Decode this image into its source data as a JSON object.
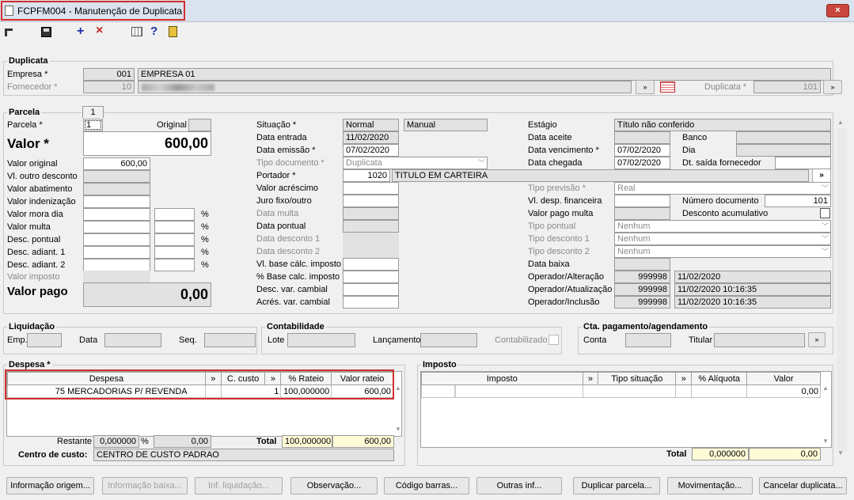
{
  "window": {
    "title": "FCPFM004 - Manutenção de Duplicata",
    "close": "×"
  },
  "toolbar": {
    "add": "+",
    "delete": "×",
    "help": "?"
  },
  "duplicata": {
    "title": "Duplicata",
    "empresa_label": "Empresa *",
    "empresa_code": "001",
    "empresa_name": "EMPRESA 01",
    "fornecedor_label": "Fornecedor *",
    "fornecedor_code": "10",
    "fornecedor_name": "",
    "duplicata_label": "Duplicata *",
    "duplicata_value": "101"
  },
  "parcela": {
    "title": "Parcela",
    "tab_number": "1",
    "parcela_label": "Parcela *",
    "parcela_value": "1",
    "original_label": "Original",
    "valor_label": "Valor *",
    "valor_value": "600,00",
    "left_fields": [
      {
        "label": "Valor original",
        "value": "600,00",
        "pct": false,
        "ro": false
      },
      {
        "label": "Vl. outro desconto",
        "value": "",
        "pct": false,
        "ro": true
      },
      {
        "label": "Valor abatimento",
        "value": "",
        "pct": false,
        "ro": true
      },
      {
        "label": "Valor indenização",
        "value": "",
        "pct": false,
        "ro": false
      },
      {
        "label": "Valor mora dia",
        "value": "",
        "pct": true,
        "ro": false
      },
      {
        "label": "Valor multa",
        "value": "",
        "pct": true,
        "ro": false
      },
      {
        "label": "Desc. pontual",
        "value": "",
        "pct": true,
        "ro": false
      },
      {
        "label": "Desc. adiant. 1",
        "value": "",
        "pct": true,
        "ro": false
      },
      {
        "label": "Desc. adiant. 2",
        "value": "",
        "pct": true,
        "ro": false
      }
    ],
    "pct_symbol": "%",
    "valor_imposto_label": "Valor imposto",
    "valor_pago_label": "Valor pago",
    "valor_pago_value": "0,00",
    "situacao_label": "Situação *",
    "situacao_value": "Normal",
    "situacao_tipo": "Manual",
    "data_entrada_label": "Data entrada",
    "data_entrada_value": "11/02/2020",
    "data_emissao_label": "Data emissão *",
    "data_emissao_value": "07/02/2020",
    "tipo_documento_label": "Tipo documento *",
    "tipo_documento_value": "Duplicata",
    "portador_label": "Portador *",
    "portador_code": "1020",
    "portador_name": "TITULO EM CARTEIRA",
    "mid_labels": [
      "Valor acréscimo",
      "Juro fixo/outro",
      "Data multa",
      "Data pontual",
      "Data desconto 1",
      "Data desconto 2",
      "Vl. base cálc. imposto",
      "% Base calc. imposto",
      "Desc. var. cambial",
      "Acrés. var. cambial"
    ],
    "estagio_label": "Estágio",
    "estagio_value": "Título não conferido",
    "data_aceite_label": "Data aceite",
    "banco_label": "Banco",
    "data_vencimento_label": "Data vencimento *",
    "data_vencimento_value": "07/02/2020",
    "dia_label": "Dia",
    "data_chegada_label": "Data chegada",
    "data_chegada_value": "07/02/2020",
    "dt_saida_label": "Dt. saída fornecedor",
    "tipo_previsao_label": "Tipo previsão *",
    "tipo_previsao_value": "Real",
    "vl_desp_label": "Vl. desp. financeira",
    "numero_documento_label": "Número documento",
    "numero_documento_value": "101",
    "valor_pago_multa_label": "Valor pago multa",
    "desconto_acumulativo_label": "Desconto acumulativo",
    "tipo_pontual_label": "Tipo pontual",
    "tipo_pontual_value": "Nenhum",
    "tipo_desconto1_label": "Tipo desconto 1",
    "tipo_desconto1_value": "Nenhum",
    "tipo_desconto2_label": "Tipo desconto 2",
    "tipo_desconto2_value": "Nenhum",
    "data_baixa_label": "Data baixa",
    "operadores": [
      {
        "label": "Operador/Alteração",
        "code": "999998",
        "date": "11/02/2020"
      },
      {
        "label": "Operador/Atualização",
        "code": "999998",
        "date": "11/02/2020 10:16:35"
      },
      {
        "label": "Operador/Inclusão",
        "code": "999998",
        "date": "11/02/2020 10:16:35"
      }
    ]
  },
  "liquidacao": {
    "title": "Liquidação",
    "emp_label": "Emp.",
    "data_label": "Data",
    "seq_label": "Seq."
  },
  "contabilidade": {
    "title": "Contabilidade",
    "lote_label": "Lote",
    "lancamento_label": "Lançamento",
    "contabilizado_label": "Contabilizado"
  },
  "cta": {
    "title": "Cta. pagamento/agendamento",
    "conta_label": "Conta",
    "titular_label": "Titular"
  },
  "despesa": {
    "title": "Despesa *",
    "headers": [
      "Despesa",
      "»",
      "C. custo",
      "»",
      "% Rateio",
      "Valor rateio"
    ],
    "rows": [
      {
        "code": "75",
        "name": "MERCADORIAS P/ REVENDA",
        "ccusto": "1",
        "rateio": "100,000000",
        "valor": "600,00"
      }
    ],
    "restante_label": "Restante",
    "restante_pct": "0,000000",
    "restante_pct_symbol": "%",
    "restante_valor": "0,00",
    "total_label": "Total",
    "total_pct": "100,000000",
    "total_valor": "600,00",
    "centro_label": "Centro de custo:",
    "centro_value": "CENTRO DE CUSTO PADRAO"
  },
  "imposto": {
    "title": "Imposto",
    "headers": [
      "Imposto",
      "»",
      "Tipo situação",
      "»",
      "% Alíquota",
      "Valor"
    ],
    "rows": [
      {
        "valor": "0,00"
      }
    ],
    "total_label": "Total",
    "total_pct": "0,000000",
    "total_valor": "0,00"
  },
  "buttons": [
    {
      "label": "Informação origem...",
      "enabled": true
    },
    {
      "label": "Informação baixa...",
      "enabled": false
    },
    {
      "label": "Inf. liquidação...",
      "enabled": false
    },
    {
      "label": "Observação...",
      "enabled": true
    },
    {
      "label": "Código barras...",
      "enabled": true
    },
    {
      "label": "Outras inf...",
      "enabled": true
    },
    {
      "label": "Duplicar parcela...",
      "enabled": true
    },
    {
      "label": "Movimentação...",
      "enabled": true
    },
    {
      "label": "Cancelar duplicata...",
      "enabled": true
    }
  ],
  "colors": {
    "highlight": "#d32f2f",
    "title_bar": "#dbe3ee",
    "close_button": "#c9463d",
    "yellow_field": "#fffbd6"
  }
}
